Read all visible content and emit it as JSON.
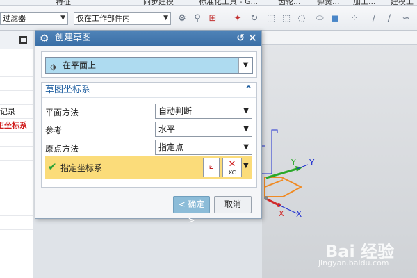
{
  "menu": [
    "特征",
    "同步建模",
    "标准化工具 - G...",
    "齿轮...",
    "弹簧...",
    "加工...",
    "建模工"
  ],
  "toolbar": {
    "filter_combo": "过滤器",
    "scope_combo": "仅在工作部件内"
  },
  "navigator": {
    "rows": [
      "",
      "",
      "",
      "",
      "记录",
      "矩坐标系",
      "",
      "",
      "",
      "",
      "",
      "",
      ""
    ]
  },
  "dialog": {
    "title": "创建草图",
    "type_value": "在平面上",
    "section_title": "草图坐标系",
    "rows": [
      {
        "label": "平面方法",
        "value": "自动判断"
      },
      {
        "label": "参考",
        "value": "水平"
      },
      {
        "label": "原点方法",
        "value": "指定点"
      }
    ],
    "csys_label": "指定坐标系",
    "csys_button_text": "XC",
    "ok_label": "< 确定 >",
    "cancel_label": "取消"
  },
  "axes": {
    "x_label": "X",
    "y_label": "Y",
    "x2_label": "X",
    "y2_label": "Y"
  },
  "watermark": {
    "brand": "Bai 经验",
    "url": "jingyan.baidu.com"
  }
}
